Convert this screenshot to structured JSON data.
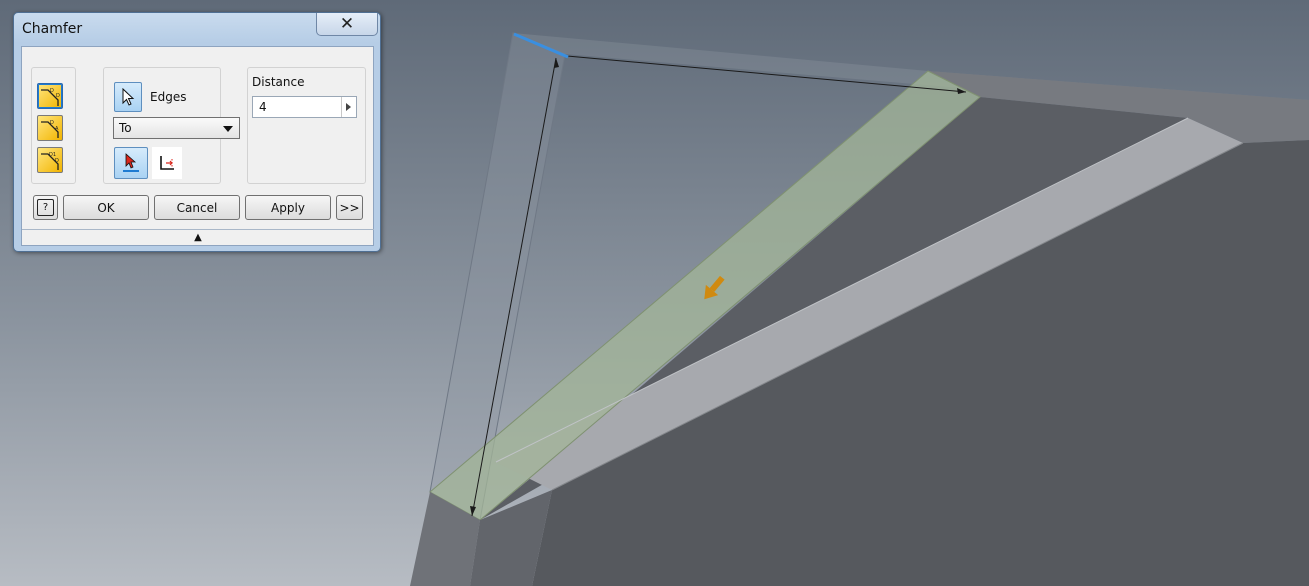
{
  "dialog": {
    "title": "Chamfer",
    "close_label": "✕",
    "edges_label": "Edges",
    "setback_select_value": "To",
    "distance_label": "Distance",
    "distance_value": "4",
    "buttons": {
      "help_label": "?",
      "ok_label": "OK",
      "cancel_label": "Cancel",
      "apply_label": "Apply",
      "more_label": ">>"
    },
    "collapse_label": "▲"
  },
  "colors": {
    "accent": "#1e7bd2",
    "face_selected": "#a3b598",
    "direction_arrow": "#d08a10"
  },
  "icons": {
    "modes": [
      "distance-chamfer-icon",
      "distance-angle-chamfer-icon",
      "two-distance-chamfer-icon"
    ],
    "edges": "select-cursor-icon",
    "edge_chain": "edge-chain-icon",
    "setback": "setback-icon"
  }
}
